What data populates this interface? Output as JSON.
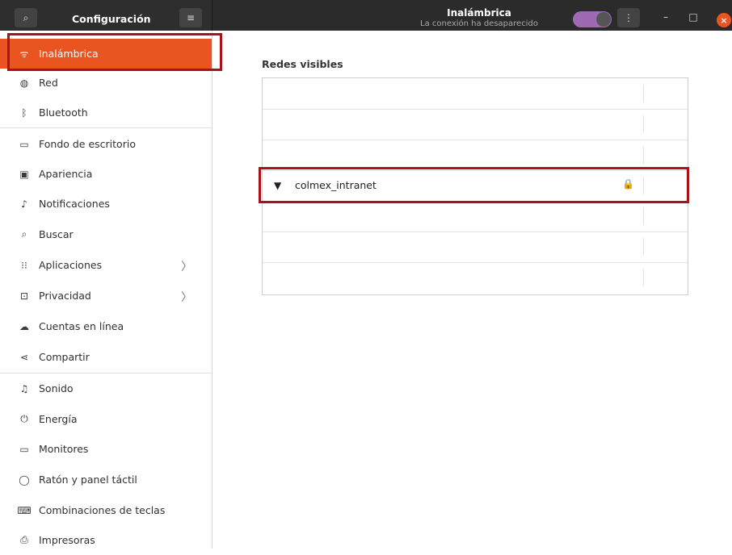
{
  "header": {
    "app_title": "Configuración",
    "window_title": "Inalámbrica",
    "window_subtitle": "La conexión ha desaparecido",
    "icons": {
      "search": "search-icon",
      "hamburger": "menu-icon",
      "kebab": "more-icon"
    },
    "wifi_toggle_on": true,
    "close_glyph": "×",
    "minimize_glyph": "–",
    "maximize_glyph": "□"
  },
  "sidebar": {
    "items": [
      {
        "label": "Inalámbrica",
        "icon": "wifi-icon",
        "active": true
      },
      {
        "label": "Red",
        "icon": "globe-icon"
      },
      {
        "label": "Bluetooth",
        "icon": "bluetooth-icon"
      },
      {
        "label": "Fondo de escritorio",
        "icon": "wallpaper-icon"
      },
      {
        "label": "Apariencia",
        "icon": "appearance-icon"
      },
      {
        "label": "Notificaciones",
        "icon": "bell-icon"
      },
      {
        "label": "Buscar",
        "icon": "search-icon"
      },
      {
        "label": "Aplicaciones",
        "icon": "apps-grid-icon",
        "chevron": true
      },
      {
        "label": "Privacidad",
        "icon": "lock-icon",
        "chevron": true
      },
      {
        "label": "Cuentas en línea",
        "icon": "cloud-icon"
      },
      {
        "label": "Compartir",
        "icon": "share-icon"
      },
      {
        "label": "Sonido",
        "icon": "music-note-icon"
      },
      {
        "label": "Energía",
        "icon": "power-icon"
      },
      {
        "label": "Monitores",
        "icon": "monitor-icon"
      },
      {
        "label": "Ratón y panel táctil",
        "icon": "mouse-icon"
      },
      {
        "label": "Combinaciones de teclas",
        "icon": "keyboard-icon"
      },
      {
        "label": "Impresoras",
        "icon": "printer-icon"
      }
    ]
  },
  "main": {
    "section_title": "Redes visibles",
    "networks": [
      {
        "ssid": ""
      },
      {
        "ssid": ""
      },
      {
        "ssid": ""
      },
      {
        "ssid": "colmex_intranet",
        "signal": true,
        "secured": true
      },
      {
        "ssid": ""
      },
      {
        "ssid": ""
      },
      {
        "ssid": ""
      }
    ]
  },
  "colors": {
    "accent": "#e95420",
    "highlight_border": "#a8121b",
    "toggle": "#9e6bb3"
  }
}
